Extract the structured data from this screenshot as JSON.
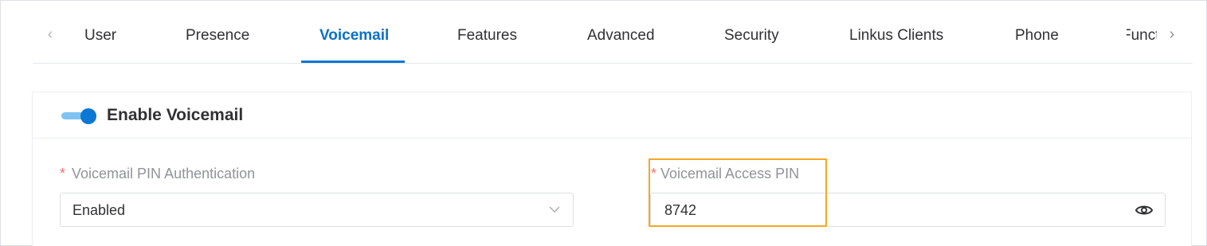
{
  "tabs": {
    "items": [
      {
        "label": "User"
      },
      {
        "label": "Presence"
      },
      {
        "label": "Voicemail"
      },
      {
        "label": "Features"
      },
      {
        "label": "Advanced"
      },
      {
        "label": "Security"
      },
      {
        "label": "Linkus Clients"
      },
      {
        "label": "Phone"
      },
      {
        "label": "Function Keys"
      }
    ],
    "active": "Voicemail",
    "prev_icon": "chevron-left-icon",
    "next_icon": "chevron-right-icon"
  },
  "voicemail": {
    "toggle_state": "on",
    "title": "Enable Voicemail",
    "pin_auth": {
      "required_mark": "*",
      "label": "Voicemail PIN Authentication",
      "value": "Enabled"
    },
    "access_pin": {
      "required_mark": "*",
      "label": "Voicemail Access PIN",
      "value": "8742",
      "visibility_icon": "eye-icon"
    }
  },
  "colors": {
    "accent": "#0b78d4",
    "highlight": "#f5a623",
    "required": "#f56c6c"
  }
}
